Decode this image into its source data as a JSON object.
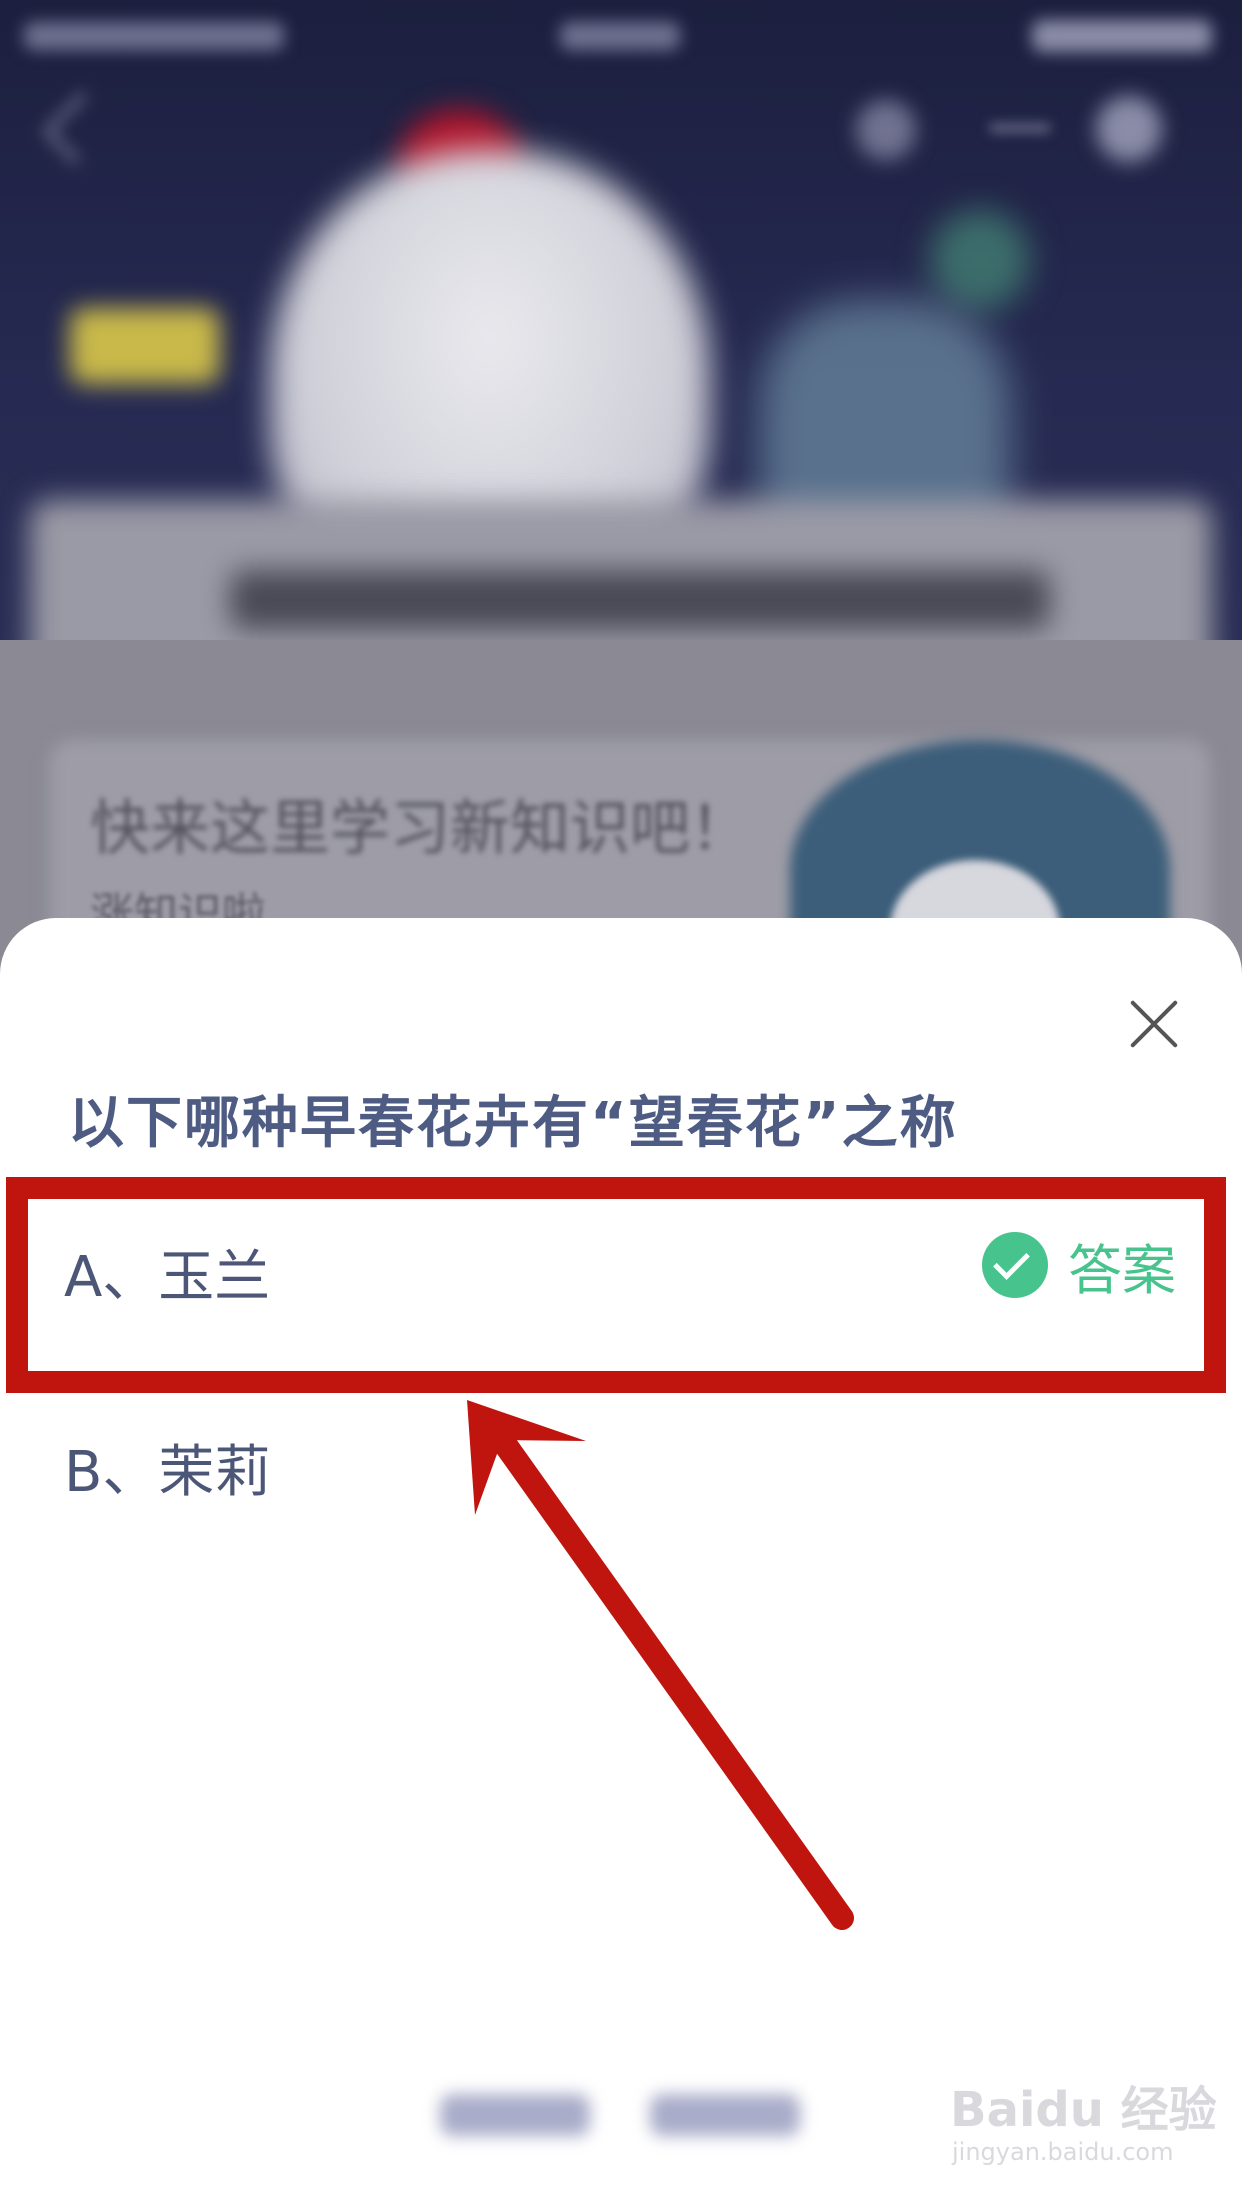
{
  "background": {
    "section_title": "快来这里学习新知识吧！",
    "section_subtitle": "涨知识啦"
  },
  "quiz": {
    "question": "以下哪种早春花卉有“望春花”之称",
    "options": [
      {
        "label": "A、玉兰",
        "is_answer": true
      },
      {
        "label": "B、茉莉",
        "is_answer": false
      }
    ],
    "answer_label": "答案"
  },
  "watermark": {
    "logo": "Baidu 经验",
    "url": "jingyan.baidu.com"
  },
  "colors": {
    "question_text": "#4e5b82",
    "answer_green": "#47c38d",
    "annotation_red": "#c0150f",
    "overlay_bg": "#1f2140"
  }
}
